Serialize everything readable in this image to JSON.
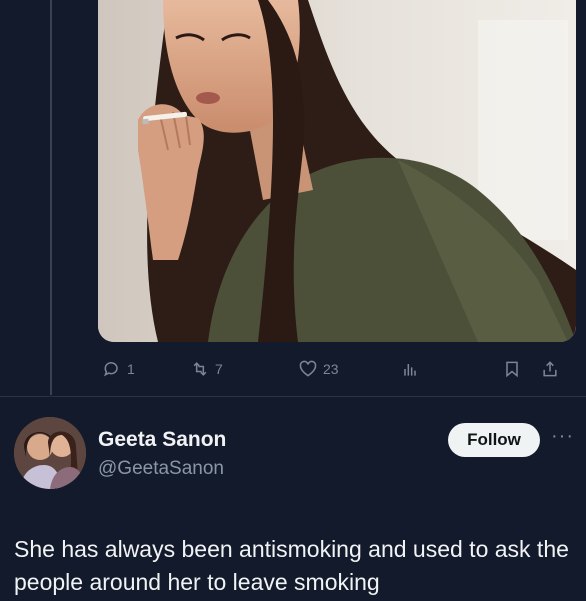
{
  "post": {
    "image_alt": "Woman with long wavy hair holding a cigarette to her lips",
    "stats": {
      "replies": "1",
      "reposts": "7",
      "likes": "23"
    }
  },
  "reply": {
    "display_name": "Geeta Sanon",
    "handle": "@GeetaSanon",
    "follow_label": "Follow",
    "more_label": "···",
    "text": "She has always been antismoking  and  used to ask the people around her to leave smoking"
  },
  "icons": {
    "reply": "reply-icon",
    "repost": "repost-icon",
    "like": "heart-icon",
    "views": "views-icon",
    "bookmark": "bookmark-icon",
    "share": "share-icon"
  },
  "colors": {
    "background": "#131a2b",
    "muted": "#7d8794",
    "follow_bg": "#eff3f4"
  }
}
